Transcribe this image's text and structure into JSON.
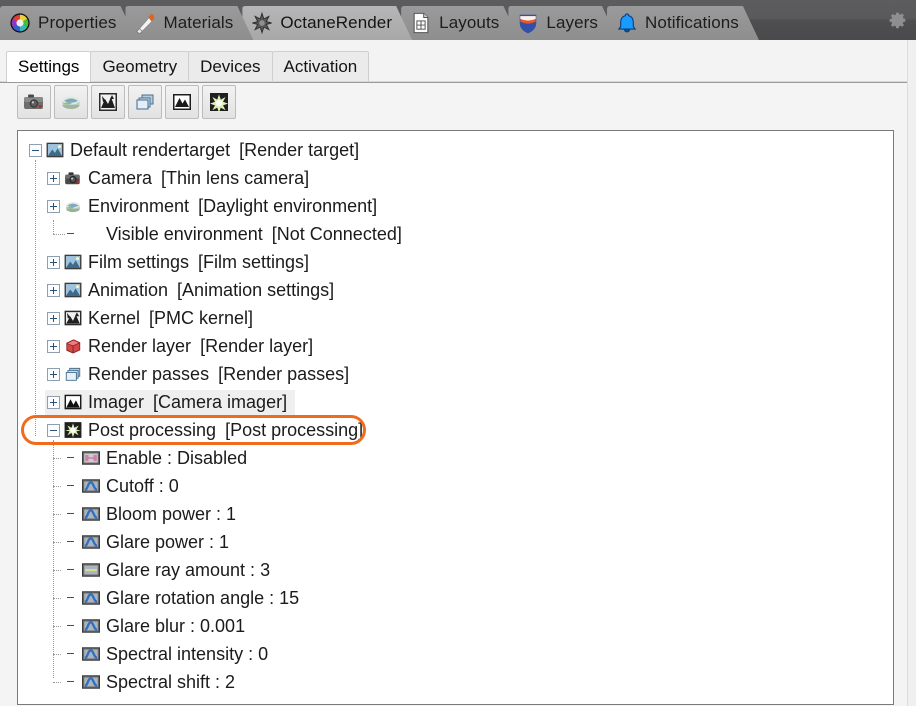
{
  "window": {
    "accent_orange": "#ef6c1e",
    "topbar_bg": "#55555 7"
  },
  "top_tabs": [
    {
      "label": "Properties",
      "icon": "color-wheel-icon",
      "active": false
    },
    {
      "label": "Materials",
      "icon": "brush-icon",
      "active": false
    },
    {
      "label": "OctaneRender",
      "icon": "octane-star-icon",
      "active": true
    },
    {
      "label": "Layouts",
      "icon": "document-icon",
      "active": false
    },
    {
      "label": "Layers",
      "icon": "shield-icon",
      "active": false
    },
    {
      "label": "Notifications",
      "icon": "bell-icon",
      "active": false
    }
  ],
  "top_right": {
    "gear": "gear-icon"
  },
  "sub_tabs": [
    {
      "label": "Settings",
      "active": true
    },
    {
      "label": "Geometry",
      "active": false
    },
    {
      "label": "Devices",
      "active": false
    },
    {
      "label": "Activation",
      "active": false
    }
  ],
  "toolbar": {
    "buttons": [
      {
        "name": "camera-button",
        "icon": "camera-icon"
      },
      {
        "name": "environment-button",
        "icon": "environment-icon"
      },
      {
        "name": "kernel-button",
        "icon": "kernel-icon"
      },
      {
        "name": "render-passes-button",
        "icon": "render-passes-icon"
      },
      {
        "name": "imager-button",
        "icon": "imager-icon"
      },
      {
        "name": "post-processing-button",
        "icon": "post-processing-icon"
      }
    ]
  },
  "tree": {
    "nodes": [
      {
        "name": "Default rendertarget",
        "type": "[Render target]",
        "icon": "image-node-icon",
        "depth": 0,
        "twist": "minus",
        "highlight": false,
        "ringed": false
      },
      {
        "name": "Camera",
        "type": "[Thin lens camera]",
        "icon": "camera-node-icon",
        "depth": 1,
        "twist": "plus",
        "highlight": false,
        "ringed": false
      },
      {
        "name": "Environment",
        "type": "[Daylight environment]",
        "icon": "environment-node-icon",
        "depth": 1,
        "twist": "plus",
        "highlight": false,
        "ringed": false
      },
      {
        "name": "Visible environment",
        "type": "[Not Connected]",
        "icon": "none",
        "depth": 2,
        "twist": "none",
        "highlight": false,
        "ringed": false
      },
      {
        "name": "Film settings",
        "type": "[Film settings]",
        "icon": "image-node-icon",
        "depth": 1,
        "twist": "plus",
        "highlight": false,
        "ringed": false
      },
      {
        "name": "Animation",
        "type": "[Animation settings]",
        "icon": "image-node-icon",
        "depth": 1,
        "twist": "plus",
        "highlight": false,
        "ringed": false
      },
      {
        "name": "Kernel",
        "type": "[PMC kernel]",
        "icon": "kernel-node-icon",
        "depth": 1,
        "twist": "plus",
        "highlight": false,
        "ringed": false
      },
      {
        "name": "Render layer",
        "type": "[Render layer]",
        "icon": "red-cube-icon",
        "depth": 1,
        "twist": "plus",
        "highlight": false,
        "ringed": false
      },
      {
        "name": "Render passes",
        "type": "[Render passes]",
        "icon": "blue-cube-icon",
        "depth": 1,
        "twist": "plus",
        "highlight": false,
        "ringed": false
      },
      {
        "name": "Imager",
        "type": "[Camera imager]",
        "icon": "imager-node-icon",
        "depth": 1,
        "twist": "plus",
        "highlight": true,
        "ringed": false
      },
      {
        "name": "Post processing",
        "type": "[Post processing]",
        "icon": "post-node-icon",
        "depth": 1,
        "twist": "minus",
        "highlight": false,
        "ringed": true
      },
      {
        "name": "Enable : Disabled",
        "type": "",
        "icon": "bool-prop-icon",
        "depth": 2,
        "twist": "none",
        "highlight": false,
        "ringed": false
      },
      {
        "name": "Cutoff : 0",
        "type": "",
        "icon": "float-prop-icon",
        "depth": 2,
        "twist": "none",
        "highlight": false,
        "ringed": false
      },
      {
        "name": "Bloom power : 1",
        "type": "",
        "icon": "float-prop-icon",
        "depth": 2,
        "twist": "none",
        "highlight": false,
        "ringed": false
      },
      {
        "name": "Glare power : 1",
        "type": "",
        "icon": "float-prop-icon",
        "depth": 2,
        "twist": "none",
        "highlight": false,
        "ringed": false
      },
      {
        "name": "Glare ray amount : 3",
        "type": "",
        "icon": "int-prop-icon",
        "depth": 2,
        "twist": "none",
        "highlight": false,
        "ringed": false
      },
      {
        "name": "Glare rotation angle : 15",
        "type": "",
        "icon": "float-prop-icon",
        "depth": 2,
        "twist": "none",
        "highlight": false,
        "ringed": false
      },
      {
        "name": "Glare blur : 0.001",
        "type": "",
        "icon": "float-prop-icon",
        "depth": 2,
        "twist": "none",
        "highlight": false,
        "ringed": false
      },
      {
        "name": "Spectral intensity : 0",
        "type": "",
        "icon": "float-prop-icon",
        "depth": 2,
        "twist": "none",
        "highlight": false,
        "ringed": false
      },
      {
        "name": "Spectral shift : 2",
        "type": "",
        "icon": "float-prop-icon",
        "depth": 2,
        "twist": "none",
        "highlight": false,
        "ringed": false
      }
    ]
  }
}
